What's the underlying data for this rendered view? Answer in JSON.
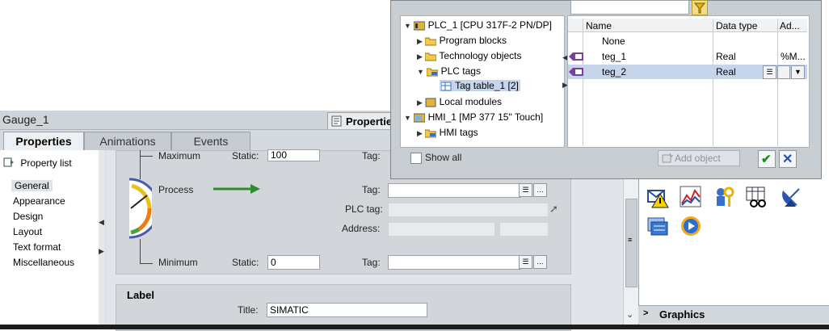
{
  "properties_panel": {
    "object_name": "Gauge_1",
    "header_tab": "Properties",
    "tabs": [
      "Properties",
      "Animations",
      "Events"
    ],
    "property_list": "Property list",
    "nav_items": [
      "General",
      "Appearance",
      "Design",
      "Layout",
      "Text format",
      "Miscellaneous"
    ],
    "rows": {
      "maximum": {
        "label": "Maximum",
        "static_label": "Static:",
        "static_value": "100",
        "tag_label": "Tag:"
      },
      "process": {
        "label": "Process",
        "tag_label": "Tag:",
        "plc_tag_label": "PLC tag:",
        "address_label": "Address:"
      },
      "minimum": {
        "label": "Minimum",
        "static_label": "Static:",
        "static_value": "0",
        "tag_label": "Tag:"
      }
    },
    "label_section": {
      "heading": "Label",
      "title_label": "Title:",
      "title_value": "SIMATIC"
    }
  },
  "dialog": {
    "tree": [
      {
        "label": "PLC_1 [CPU 317F-2 PN/DP]",
        "level": 0,
        "expanded": true
      },
      {
        "label": "Program blocks",
        "level": 1,
        "expanded": false
      },
      {
        "label": "Technology objects",
        "level": 1,
        "expanded": false
      },
      {
        "label": "PLC tags",
        "level": 1,
        "expanded": true
      },
      {
        "label": "Tag table_1 [2]",
        "level": 2,
        "selected": true
      },
      {
        "label": "Local modules",
        "level": 1,
        "expanded": false
      },
      {
        "label": "HMI_1 [MP 377 15\" Touch]",
        "level": 0,
        "expanded": true
      },
      {
        "label": "HMI tags",
        "level": 1,
        "expanded": false
      }
    ],
    "grid": {
      "columns": [
        "Name",
        "Data type",
        "Ad..."
      ],
      "rows": [
        {
          "name": "None",
          "type": "",
          "addr": ""
        },
        {
          "name": "teg_1",
          "type": "Real",
          "addr": "%M..."
        },
        {
          "name": "teg_2",
          "type": "Real",
          "addr": "",
          "selected": true
        }
      ]
    },
    "show_all": "Show all",
    "add_object": "Add object"
  },
  "right_panel": {
    "graphics_label": "Graphics"
  },
  "colors": {
    "accent": "#1f7a1f",
    "selection": "#c7d5ec"
  }
}
